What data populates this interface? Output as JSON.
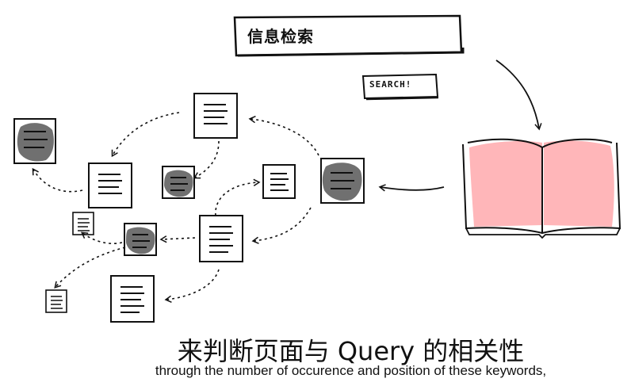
{
  "search": {
    "query": "信息检索"
  },
  "search_tag": "SEARCH!",
  "caption": {
    "title": "来判断页面与 Query 的相关性",
    "subtitle": "through the number of occurence and position of these keywords,"
  },
  "colors": {
    "ink": "#111111",
    "highlight": "#ffb6b9",
    "scribble": "#707070"
  }
}
